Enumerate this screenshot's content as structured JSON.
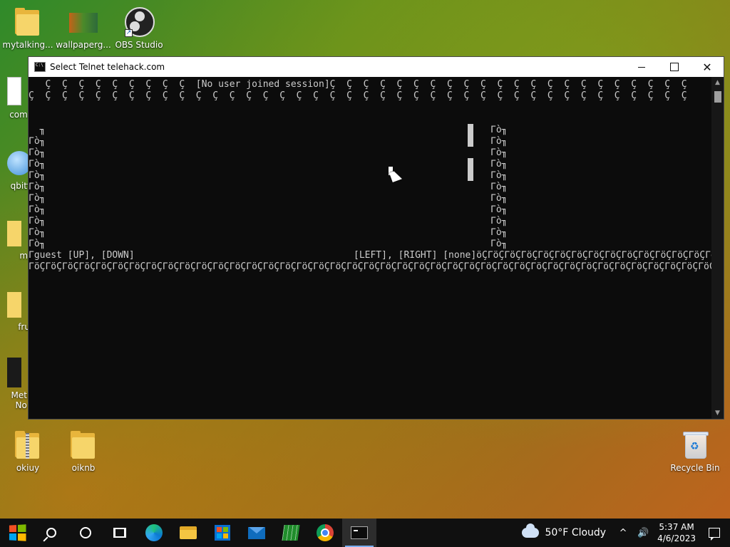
{
  "desktop": {
    "icons": [
      {
        "label": "mytalking...",
        "icon": "folder-icon"
      },
      {
        "label": "wallpaperg...",
        "icon": "image-file-icon"
      },
      {
        "label": "OBS Studio",
        "icon": "obs-studio-icon"
      },
      {
        "label": "com.o",
        "icon": "file-icon"
      },
      {
        "label": "qbitto",
        "icon": "qbittorrent-icon"
      },
      {
        "label": "min",
        "icon": "folder-icon"
      },
      {
        "label": "fruit",
        "icon": "folder-icon"
      },
      {
        "label": "Metro\nNo C",
        "icon": "app-icon"
      },
      {
        "label": "okiuy",
        "icon": "zip-folder-icon"
      },
      {
        "label": "oiknb",
        "icon": "folder-icon"
      },
      {
        "label": "Recycle Bin",
        "icon": "recycle-bin-icon"
      }
    ]
  },
  "window": {
    "title": "Select Telnet telehack.com",
    "controls": {
      "minimize": "",
      "maximize": "",
      "close": "✕"
    }
  },
  "console": {
    "header_line1": "   Ç  Ç  Ç  Ç  Ç  Ç  Ç  Ç  Ç  [No user joined session]Ç  Ç  Ç  Ç  Ç  Ç  Ç  Ç  Ç  Ç  Ç  Ç  Ç  Ç  Ç  Ç  Ç  Ç  Ç  Ç  Ç  Ç",
    "header_line2": "Ç  Ç  Ç  Ç  Ç  Ç  Ç  Ç  Ç  Ç  Ç  Ç  Ç  Ç  Ç  Ç  Ç  Ç  Ç  Ç  Ç  Ç  Ç  Ç  Ç  Ç  Ç  Ç  Ç  Ç  Ç  Ç  Ç  Ç  Ç  Ç  Ç  Ç  Ç  Ç",
    "left_wall_first": "  ╖",
    "left_wall": "Γò╖",
    "right_wall": "Γò╖",
    "footer_left": "Γguest [UP], [DOWN]",
    "footer_right": "[LEFT], [RIGHT] [none]öÇΓöÇΓöÇΓöÇΓöÇΓöÇΓöÇΓöÇΓöÇΓöÇΓöÇΓöÇΓöÇΓöÇΓöÇΓöÇΓöÇΓöÇΓöÇ",
    "footer_line2": "ΓöÇΓöÇΓöÇΓöÇΓöÇΓöÇΓöÇΓöÇΓöÇΓöÇΓöÇΓöÇΓöÇΓöÇΓöÇΓöÇΓöÇΓöÇΓöÇΓöÇΓöÇΓöÇΓöÇΓöÇΓöÇΓöÇΓöÇΓöÇΓöÇΓöÇΓöÇΓöÇΓöÇΓöÇΓöÇΓöÇΓöÇΓöÇΓöÇΓöÇΓöÇΓöÇΓöÇΓöÇΓöÇΓöÇΓöÇΓöÇΓöÇΓöÇΓöÇΓöÇΓöÇΓöÇΓöÇΓöÇΓöÇΓöÇΓöÇΓöÇΓöÇΓöÇΓöÇΓöÇΓöÇΓöÇΓöÇΓöÇΓöÇΓöÇΓöÇΓöÇΓöÇΓöÇΓöÇΓöÇΓöÇΓöÇΓöÇΓöÇΓö»"
  },
  "taskbar": {
    "items": [
      "start-button",
      "search-button",
      "cortana-button",
      "task-view-button",
      "edge",
      "file-explorer",
      "store",
      "mail",
      "spreadsheet-app",
      "chrome",
      "command-prompt"
    ],
    "weather_temp": "50°F",
    "weather_text": "Cloudy",
    "tray_chevron": "^",
    "volume": "🔊",
    "time": "5:37 AM",
    "date": "4/6/2023"
  }
}
